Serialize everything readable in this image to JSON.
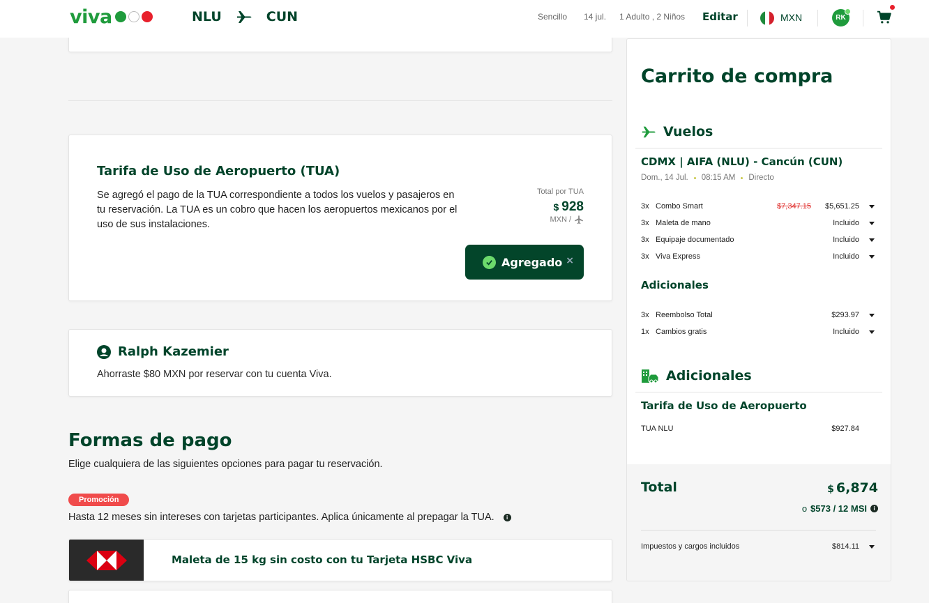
{
  "header": {
    "logo_text": "viva",
    "origin": "NLU",
    "destination": "CUN",
    "trip_type": "Sencillo",
    "date": "14 jul.",
    "passengers": "1 Adulto , 2 Niños",
    "edit_label": "Editar",
    "currency": "MXN",
    "avatar_initials": "RK",
    "icons": [
      "plane-icon",
      "flag-mexico-icon",
      "cart-icon"
    ]
  },
  "tua_card": {
    "title": "Tarifa de Uso de Aeropuerto (TUA)",
    "description": "Se agregó el pago de la TUA correspondiente a todos los vuelos y pasajeros en tu reservación. La TUA es un cobro que hacen los aeropuertos mexicanos por el uso de sus instalaciones.",
    "total_label": "Total por TUA",
    "currency_symbol": "$",
    "total_value": "928",
    "unit": "MXN /",
    "added_button": "Agregado",
    "remove_symbol": "×"
  },
  "user_card": {
    "name": "Ralph Kazemier",
    "savings": "Ahorraste $80 MXN por reservar con tu cuenta Viva."
  },
  "payment": {
    "title": "Formas de pago",
    "subtitle": "Elige cualquiera de las siguientes opciones para pagar tu reservación.",
    "promo_badge": "Promoción",
    "promo_text": "Hasta 12 meses sin intereses con tarjetas participantes. Aplica únicamente al prepagar la TUA.",
    "hsbc_offer": "Maleta de 15 kg sin costo con tu Tarjeta HSBC Viva"
  },
  "cart": {
    "title": "Carrito de compra",
    "flights_heading": "Vuelos",
    "route": "CDMX | AIFA (NLU) - Cancún (CUN)",
    "route_date": "Dom., 14 Jul.",
    "route_time": "08:15 AM",
    "route_type": "Directo",
    "flight_items": [
      {
        "qty": "3x",
        "name": "Combo Smart",
        "old_price": "$7,347.15",
        "price": "$5,651.25"
      },
      {
        "qty": "3x",
        "name": "Maleta de mano",
        "old_price": "",
        "price": "Incluido"
      },
      {
        "qty": "3x",
        "name": "Equipaje documentado",
        "old_price": "",
        "price": "Incluido"
      },
      {
        "qty": "3x",
        "name": "Viva Express",
        "old_price": "",
        "price": "Incluido"
      }
    ],
    "extras_subheading": "Adicionales",
    "extra_items": [
      {
        "qty": "3x",
        "name": "Reembolso Total",
        "price": "$293.97"
      },
      {
        "qty": "1x",
        "name": "Cambios gratis",
        "price": "Incluido"
      }
    ],
    "additionals_heading": "Adicionales",
    "tua_subheading": "Tarifa de Uso de Aeropuerto",
    "tua_item_name": "TUA NLU",
    "tua_item_price": "$927.84",
    "total_label": "Total",
    "total_currency": "$",
    "total_value": "6,874",
    "msi_prefix": "o",
    "msi_text": "$573 / 12 MSI",
    "taxes_label": "Impuestos y cargos incluidos",
    "taxes_value": "$814.11"
  },
  "colors": {
    "brand_green": "#00442a",
    "logo_green": "#1f9b3c",
    "promo_red": "#f04b4b",
    "strike_red": "#e0302e"
  }
}
